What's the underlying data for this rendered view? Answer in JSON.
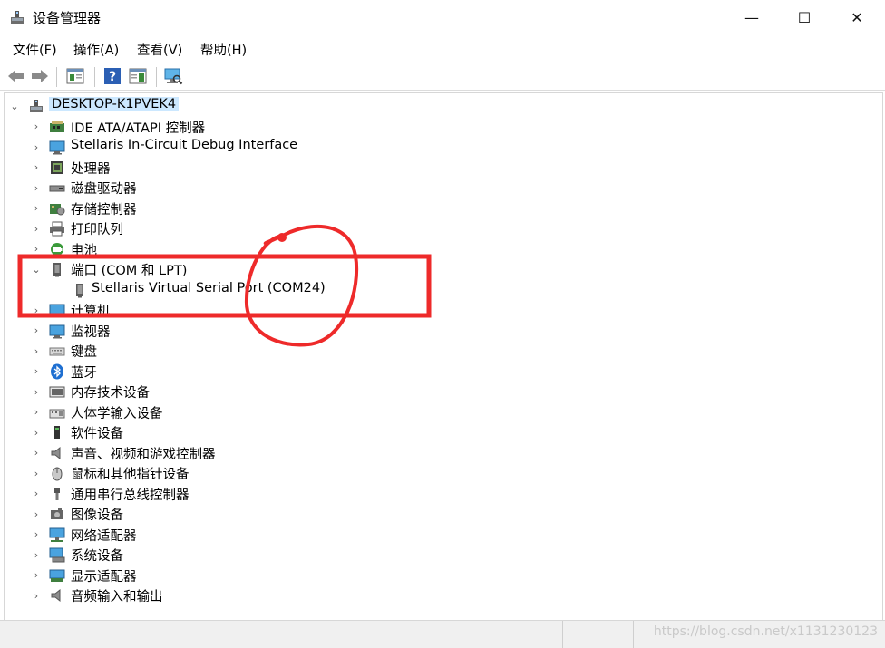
{
  "window": {
    "title": "设备管理器",
    "min_glyph": "—",
    "max_glyph": "☐",
    "close_glyph": "✕"
  },
  "menu": [
    "文件(F)",
    "操作(A)",
    "查看(V)",
    "帮助(H)"
  ],
  "tree": {
    "root": "DESKTOP-K1PVEK4",
    "items": [
      {
        "label": "IDE ATA/ATAPI 控制器",
        "icon": "ide-controller-icon"
      },
      {
        "label": "Stellaris In-Circuit Debug Interface",
        "icon": "debug-interface-icon"
      },
      {
        "label": "处理器",
        "icon": "processor-icon"
      },
      {
        "label": "磁盘驱动器",
        "icon": "disk-drive-icon"
      },
      {
        "label": "存储控制器",
        "icon": "storage-controller-icon"
      },
      {
        "label": "打印队列",
        "icon": "printer-icon"
      },
      {
        "label": "电池",
        "icon": "battery-icon"
      },
      {
        "label": "端口 (COM 和 LPT)",
        "icon": "port-icon",
        "expanded": true
      },
      {
        "label": "Stellaris Virtual Serial Port (COM24)",
        "icon": "serial-port-icon",
        "child": true
      },
      {
        "label": "计算机",
        "icon": "computer-icon"
      },
      {
        "label": "监视器",
        "icon": "monitor-icon"
      },
      {
        "label": "键盘",
        "icon": "keyboard-icon"
      },
      {
        "label": "蓝牙",
        "icon": "bluetooth-icon"
      },
      {
        "label": "内存技术设备",
        "icon": "memory-device-icon"
      },
      {
        "label": "人体学输入设备",
        "icon": "hid-icon"
      },
      {
        "label": "软件设备",
        "icon": "software-device-icon"
      },
      {
        "label": "声音、视频和游戏控制器",
        "icon": "sound-icon"
      },
      {
        "label": "鼠标和其他指针设备",
        "icon": "mouse-icon"
      },
      {
        "label": "通用串行总线控制器",
        "icon": "usb-icon"
      },
      {
        "label": "图像设备",
        "icon": "imaging-device-icon"
      },
      {
        "label": "网络适配器",
        "icon": "network-adapter-icon"
      },
      {
        "label": "系统设备",
        "icon": "system-device-icon"
      },
      {
        "label": "显示适配器",
        "icon": "display-adapter-icon"
      },
      {
        "label": "音频输入和输出",
        "icon": "audio-io-icon"
      }
    ]
  },
  "watermark": "https://blog.csdn.net/x1131230123",
  "colors": {
    "selection": "#cce8ff",
    "annotation": "#ee2a2a"
  }
}
